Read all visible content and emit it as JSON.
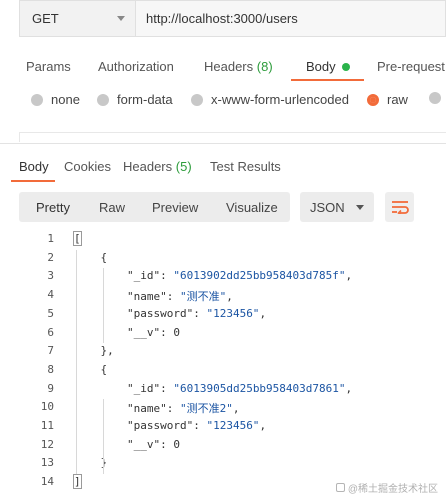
{
  "request": {
    "method": "GET",
    "url": "http://localhost:3000/users"
  },
  "request_tabs": {
    "params": "Params",
    "authorization": "Authorization",
    "headers": "Headers",
    "headers_count": "(8)",
    "body": "Body",
    "prerequest": "Pre-request"
  },
  "body_types": {
    "none": "none",
    "form_data": "form-data",
    "urlencoded": "x-www-form-urlencoded",
    "raw": "raw",
    "selected": "raw"
  },
  "response_tabs": {
    "body": "Body",
    "cookies": "Cookies",
    "headers": "Headers",
    "headers_count": "(5)",
    "test_results": "Test Results"
  },
  "response_toolbar": {
    "pretty": "Pretty",
    "raw": "Raw",
    "preview": "Preview",
    "visualize": "Visualize",
    "format": "JSON"
  },
  "code": {
    "line_numbers": [
      "1",
      "2",
      "3",
      "4",
      "5",
      "6",
      "7",
      "8",
      "9",
      "10",
      "11",
      "12",
      "13",
      "14"
    ],
    "lines": [
      "[",
      "    {",
      "        \"_id\": \"6013902dd25bb958403d785f\",",
      "        \"name\": \"测不准\",",
      "        \"password\": \"123456\",",
      "        \"__v\": 0",
      "    },",
      "    {",
      "        \"_id\": \"6013905dd25bb958403d7861\",",
      "        \"name\": \"测不准2\",",
      "        \"password\": \"123456\",",
      "        \"__v\": 0",
      "    }",
      "]"
    ]
  },
  "watermark": "@稀土掘金技术社区",
  "colors": {
    "accent": "#f26b3a",
    "green": "#2ab34b",
    "string": "#1c55a3"
  }
}
